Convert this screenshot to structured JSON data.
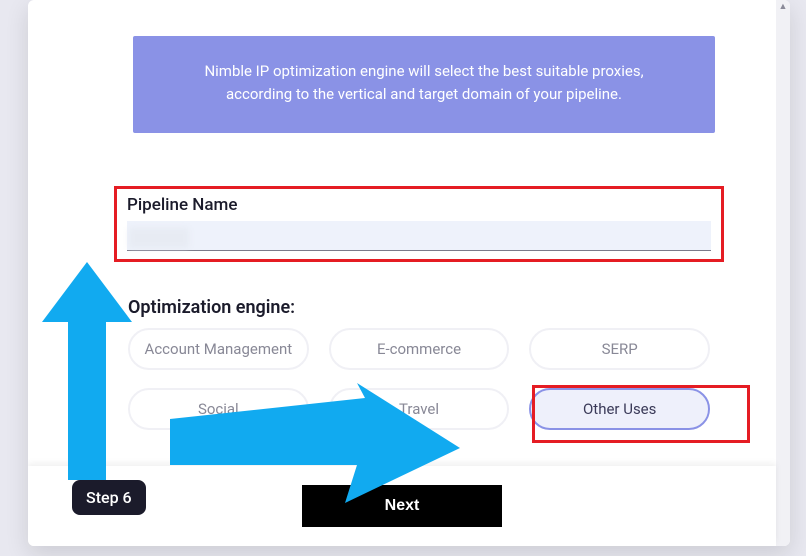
{
  "banner": {
    "line1": "Nimble IP optimization engine will select the best suitable proxies,",
    "line2": "according to the vertical and target domain of your pipeline."
  },
  "pipeline": {
    "label": "Pipeline Name",
    "value": ""
  },
  "optimization": {
    "label": "Optimization engine:",
    "options": {
      "account_mgmt": "Account Management",
      "ecommerce": "E-commerce",
      "serp": "SERP",
      "social": "Social",
      "travel": "Travel",
      "other": "Other Uses"
    }
  },
  "footer": {
    "next": "Next"
  },
  "annotation": {
    "step": "Step 6"
  },
  "colors": {
    "accent": "#8a92e6",
    "highlight": "#e51c23",
    "arrow": "#11aaf0"
  }
}
